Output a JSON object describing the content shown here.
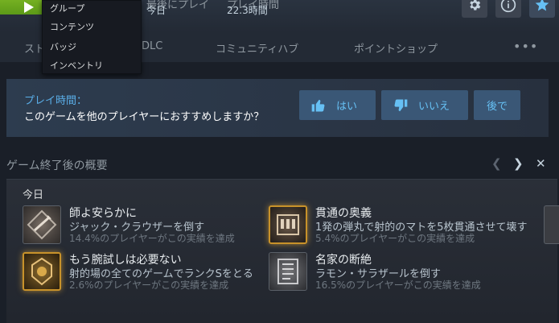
{
  "header": {
    "stat1_label": "最後にプレイ",
    "stat1_value": "今日",
    "stat2_label": "プレイ時間",
    "stat2_value": "22.3時間",
    "icons": [
      "play-icon",
      "gear-icon",
      "info-icon",
      "star-icon"
    ]
  },
  "nav": {
    "tabs": [
      "ストア",
      "DLC",
      "コミュニティハブ",
      "ポイントショップ"
    ],
    "more": "•••"
  },
  "menu": {
    "items": [
      "グループ",
      "コンテンツ",
      "バッジ",
      "インベントリ"
    ]
  },
  "review": {
    "playtime_label": "プレイ時間：",
    "question": "このゲームを他のプレイヤーにおすすめしますか？",
    "yes": "はい",
    "no": "いいえ",
    "later": "後で"
  },
  "summary": {
    "title": "ゲーム終了後の概要",
    "today": "今日",
    "achievements": [
      {
        "name": "師よ安らかに",
        "desc": "ジャック・クラウザーを倒す",
        "pct": "14.4%のプレイヤーがこの実績を達成"
      },
      {
        "name": "貫通の奥義",
        "desc": "1発の弾丸で射的のマトを5枚貫通させて壊す",
        "pct": "5.4%のプレイヤーがこの実績を達成"
      },
      {
        "name": "もう腕試しは必要ない",
        "desc": "射的場の全てのゲームでランクSをとる",
        "pct": "2.6%のプレイヤーがこの実績を達成"
      },
      {
        "name": "名家の断絶",
        "desc": "ラモン・サラザールを倒す",
        "pct": "16.5%のプレイヤーがこの実績を達成"
      }
    ]
  },
  "colors": {
    "accent": "#66c0f4",
    "play_green": "#75b022",
    "gold": "#c8922a"
  }
}
